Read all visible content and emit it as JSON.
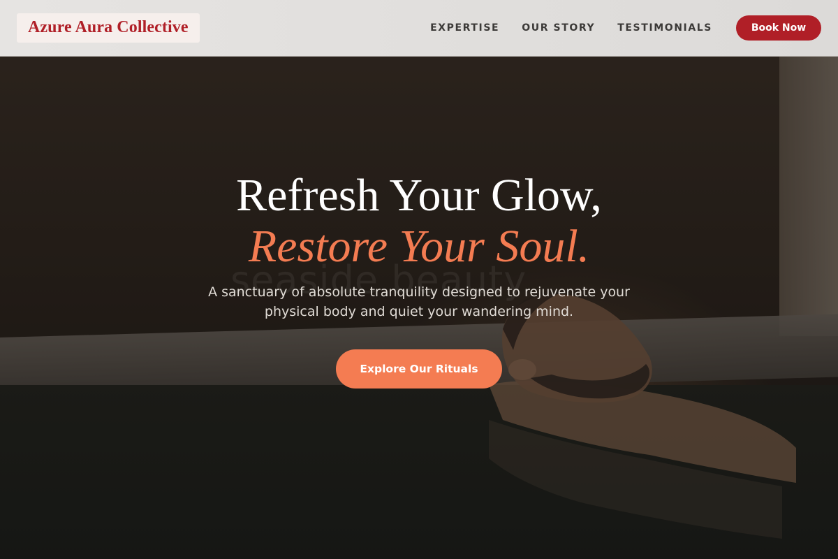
{
  "brand": {
    "name": "Azure Aura Collective",
    "color": "#b01f27"
  },
  "nav": {
    "items": [
      {
        "label": "EXPERTISE"
      },
      {
        "label": "OUR STORY"
      },
      {
        "label": "TESTIMONIALS"
      }
    ],
    "cta_label": "Book Now"
  },
  "hero": {
    "title_line1": "Refresh Your Glow,",
    "title_line2": "Restore Your Soul.",
    "subtitle": "A sanctuary of absolute tranquility designed to rejuvenate your physical body and quiet your wandering mind.",
    "cta_label": "Explore Our Rituals",
    "background_watermark": "seaside beauty",
    "accent_color": "#f47c52"
  }
}
